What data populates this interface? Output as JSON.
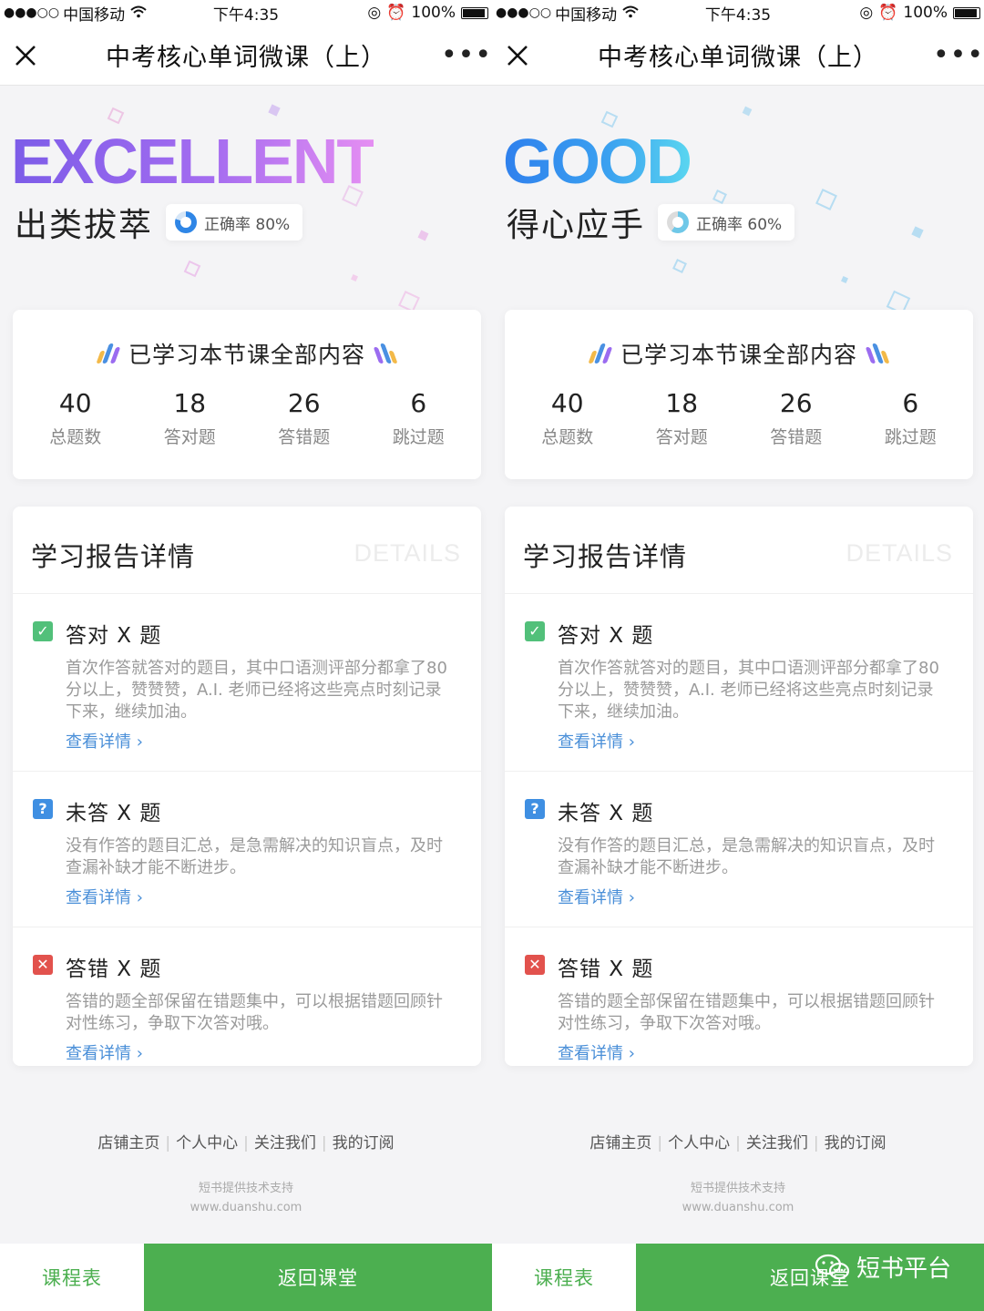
{
  "status_bar": {
    "signal": "●●●○○",
    "carrier": "中国移动",
    "time": "下午4:35",
    "battery_percent": "100%"
  },
  "nav": {
    "title": "中考核心单词微课（上）"
  },
  "screens": [
    {
      "big_word": "EXCELLENT",
      "grade_text": "出类拔萃",
      "accuracy_label": "正确率 80%",
      "accuracy_value": 0.8
    },
    {
      "big_word": "GOOD",
      "grade_text": "得心应手",
      "accuracy_label": "正确率 60%",
      "accuracy_value": 0.6
    }
  ],
  "summary": {
    "heading": "已学习本节课全部内容",
    "stats": [
      {
        "value": "40",
        "label": "总题数"
      },
      {
        "value": "18",
        "label": "答对题"
      },
      {
        "value": "26",
        "label": "答错题"
      },
      {
        "value": "6",
        "label": "跳过题"
      }
    ]
  },
  "details": {
    "title": "学习报告详情",
    "watermark": "DETAILS",
    "items": [
      {
        "icon": "check-icon",
        "title": "答对 X 题",
        "desc": "首次作答就答对的题目，其中口语测评部分都拿了80分以上，赞赞赞，A.I. 老师已经将这些亮点时刻记录下来，继续加油。",
        "link": "查看详情 ›"
      },
      {
        "icon": "question-icon",
        "title": "未答 X 题",
        "desc": "没有作答的题目汇总，是急需解决的知识盲点，及时查漏补缺才能不断进步。",
        "link": "查看详情 ›"
      },
      {
        "icon": "cross-icon",
        "title": "答错 X 题",
        "desc": "答错的题全部保留在错题集中，可以根据错题回顾针对性练习，争取下次答对哦。",
        "link": "查看详情 ›"
      }
    ]
  },
  "footer": {
    "links": [
      "店铺主页",
      "个人中心",
      "关注我们",
      "我的订阅"
    ],
    "support_line1": "短书提供技术支持",
    "support_line2": "www.duanshu.com"
  },
  "bottom_bar": {
    "schedule": "课程表",
    "back": "返回课堂"
  },
  "watermark_text": "短书平台",
  "colors": {
    "green": "#4caf50",
    "link_blue": "#4a8fd8",
    "excellent_gradient": [
      "#7c5ce8",
      "#e58ef2"
    ],
    "good_gradient": [
      "#2f80ed",
      "#5ad6f0"
    ]
  }
}
